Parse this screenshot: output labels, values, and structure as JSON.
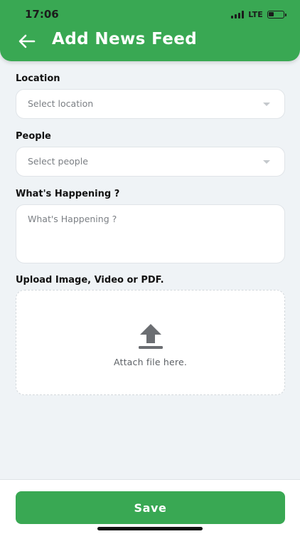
{
  "status_bar": {
    "time": "17:06",
    "network": "LTE",
    "battery_level": 0.35
  },
  "header": {
    "back_icon": "arrow-left-icon",
    "title": "Add News Feed"
  },
  "form": {
    "location": {
      "label": "Location",
      "placeholder": "Select location"
    },
    "people": {
      "label": "People",
      "placeholder": "Select people"
    },
    "happening": {
      "label": "What's Happening ?",
      "placeholder": "What's Happening ?"
    },
    "upload": {
      "label": "Upload Image, Video or PDF.",
      "hint": "Attach file here.",
      "icon": "upload-icon"
    }
  },
  "footer": {
    "save_label": "Save"
  },
  "colors": {
    "brand": "#39a853",
    "background": "#eff3f6"
  }
}
